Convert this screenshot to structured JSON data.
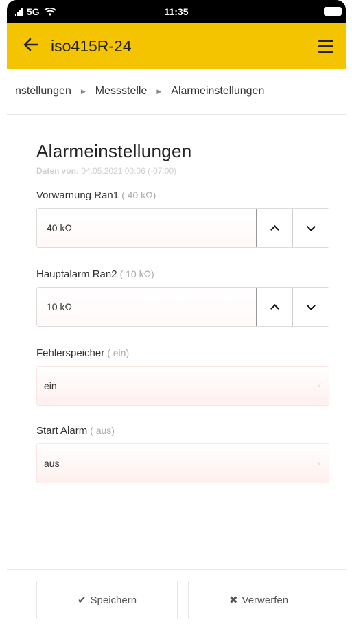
{
  "status_bar": {
    "network": "5G",
    "time": "11:35"
  },
  "app_bar": {
    "title": "iso415R-24",
    "back_icon": "arrow-left-icon",
    "menu_icon": "hamburger-menu-icon"
  },
  "breadcrumb": {
    "items": [
      "nstellungen",
      "Messstelle",
      "Alarmeinstellungen"
    ]
  },
  "page": {
    "title": "Alarmeinstellungen",
    "date_prefix": "Daten von:",
    "date_value": "04.05.2021 00:06 (-07:00)"
  },
  "fields": {
    "vorwarnung": {
      "label": "Vorwarnung Ran1",
      "hint": "( 40 kΩ)",
      "value": "40 kΩ"
    },
    "hauptalarm": {
      "label": "Hauptalarm Ran2",
      "hint": "( 10 kΩ)",
      "value": "10 kΩ"
    },
    "fehlerspeicher": {
      "label": "Fehlerspeicher",
      "hint": "( ein)",
      "value": "ein"
    },
    "start_alarm": {
      "label": "Start Alarm",
      "hint": "( aus)",
      "value": "aus"
    }
  },
  "footer": {
    "save_label": "Speichern",
    "discard_label": "Verwerfen",
    "save_icon": "check-icon",
    "discard_icon": "x-icon"
  },
  "colors": {
    "accent": "#f5c400"
  }
}
